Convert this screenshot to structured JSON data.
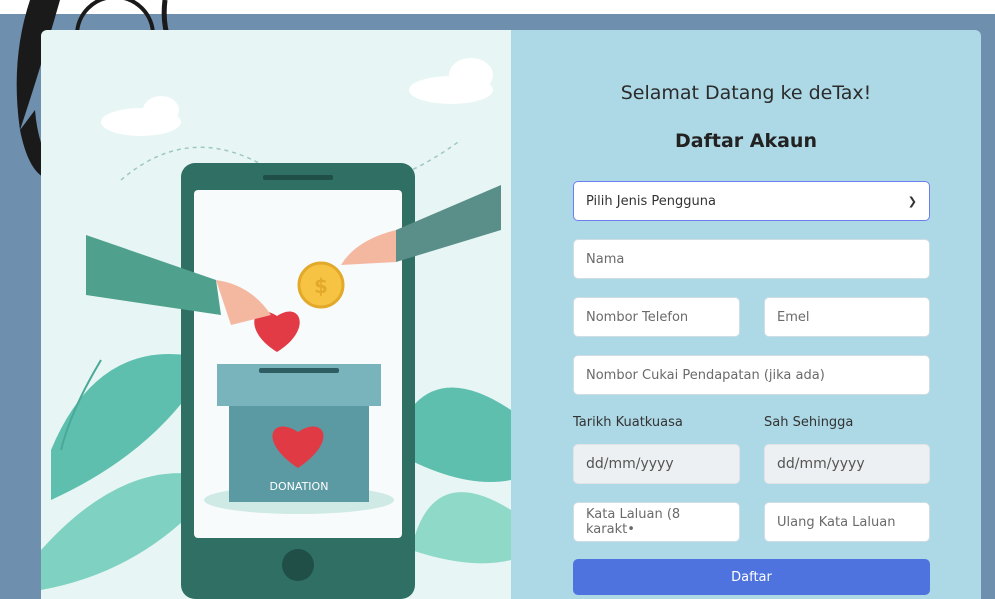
{
  "form": {
    "welcome": "Selamat Datang ke deTax!",
    "heading": "Daftar Akaun",
    "user_type_select": "Pilih Jenis Pengguna",
    "name_placeholder": "Nama",
    "phone_placeholder": "Nombor Telefon",
    "email_placeholder": "Emel",
    "tax_placeholder": "Nombor Cukai Pendapatan (jika ada)",
    "effective_date_label": "Tarikh Kuatkuasa",
    "valid_until_label": "Sah Sehingga",
    "date_placeholder": "dd/mm/yyyy",
    "password_placeholder": "Kata Laluan (8 karakt•",
    "confirm_password_placeholder": "Ulang Kata Laluan",
    "submit_label": "Daftar"
  },
  "illustration": {
    "box_label": "DONATION"
  },
  "colors": {
    "page_bg": "#6f8fae",
    "form_bg": "#add8e6",
    "illustration_bg": "#e7f6f4",
    "button": "#4e73df"
  }
}
